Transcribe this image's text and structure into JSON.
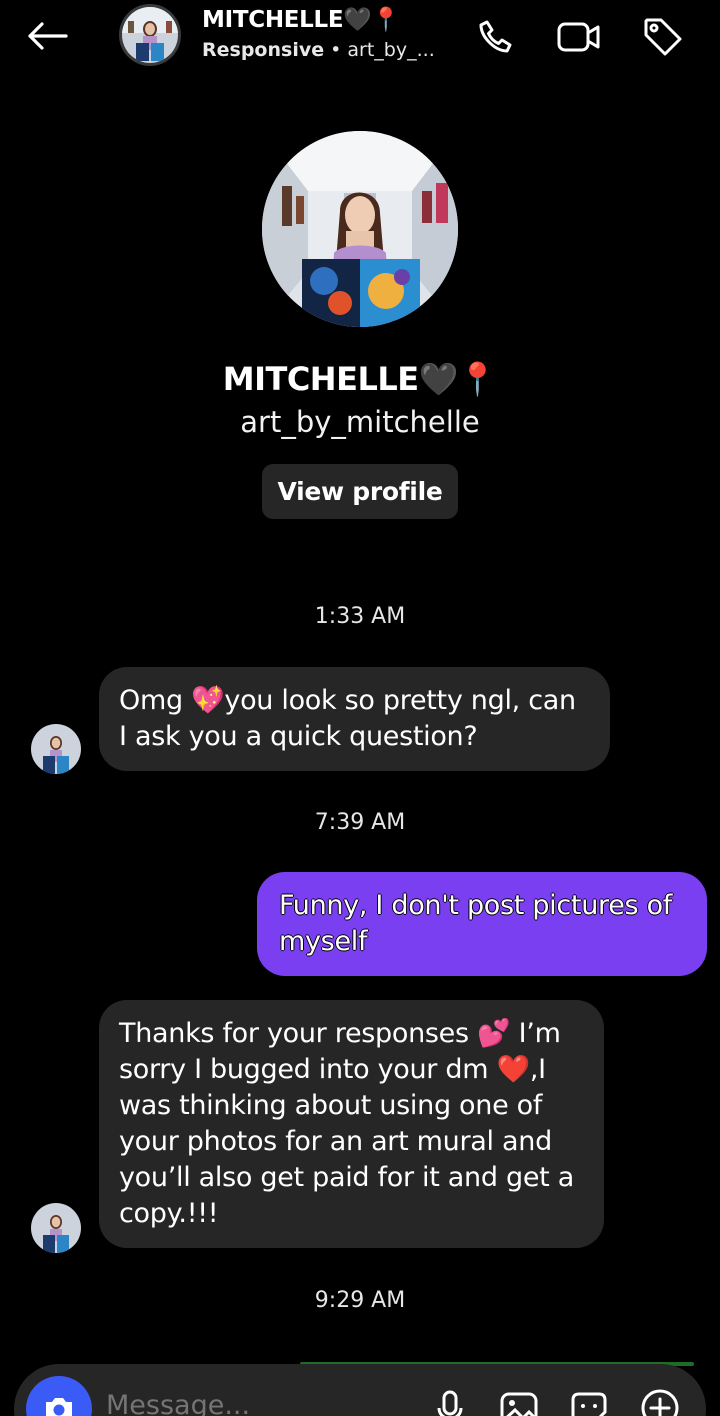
{
  "header": {
    "name": "MITCHELLE🖤📍",
    "status": "Responsive",
    "separator": " • ",
    "handle_short": "art_by_..."
  },
  "profile": {
    "name": "MITCHELLE🖤📍",
    "handle": "art_by_mitchelle",
    "view_profile_label": "View profile"
  },
  "messages": [
    {
      "timestamp": "1:33 AM"
    },
    {
      "direction": "incoming",
      "text": "Omg 💖you look so pretty ngl, can I ask you a quick question?"
    },
    {
      "timestamp": "7:39 AM"
    },
    {
      "direction": "outgoing",
      "text": "Funny, I don't post pictures of myself"
    },
    {
      "direction": "incoming",
      "text": "Thanks for your responses 💕 I’m sorry I bugged into your dm ❤️,I was thinking about using one of your photos for an art mural and you’ll also get paid for it and get a copy.!!!"
    },
    {
      "timestamp": "9:29 AM"
    }
  ],
  "composer": {
    "placeholder": "Message..."
  },
  "colors": {
    "background": "#000000",
    "incoming_bubble": "#262626",
    "outgoing_bubble": "#7b3ff2",
    "camera_button": "#3b5bf6"
  },
  "icons": {
    "back": "arrow-left-icon",
    "call": "phone-icon",
    "video": "video-camera-icon",
    "tag": "tag-icon",
    "camera": "camera-icon",
    "mic": "microphone-icon",
    "gallery": "image-icon",
    "sticker": "sticker-icon",
    "add": "plus-circle-icon"
  }
}
